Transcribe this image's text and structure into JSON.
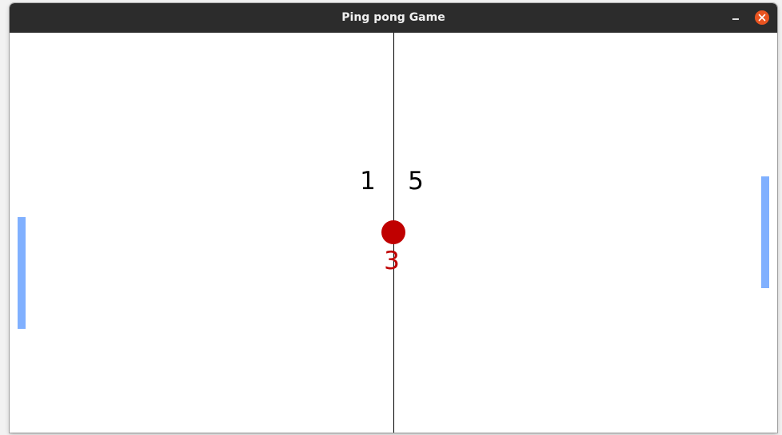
{
  "window": {
    "title": "Ping pong Game"
  },
  "controls": {
    "minimize_icon": "minimize-icon",
    "close_icon": "close-icon"
  },
  "scores": {
    "left": "1",
    "right": "5"
  },
  "ball_counter": "3",
  "colors": {
    "titlebar": "#2c2c2c",
    "title_text": "#f0f0f0",
    "close_button": "#e95420",
    "paddle": "#80b0ff",
    "ball": "#c00000",
    "counter_text": "#c00000",
    "net": "#000000",
    "background": "#ffffff"
  }
}
